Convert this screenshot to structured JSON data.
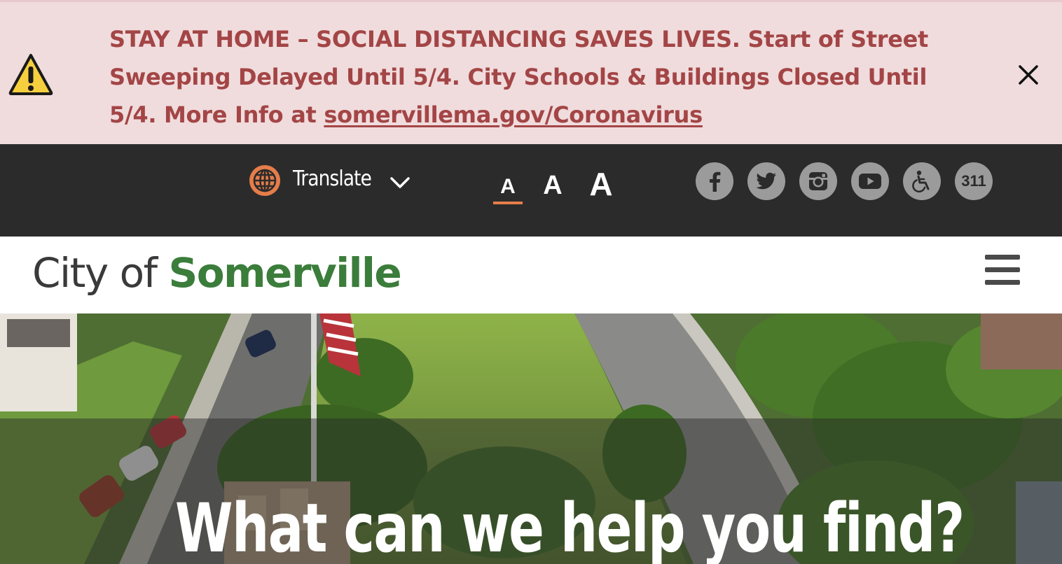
{
  "alert": {
    "text": "STAY AT HOME – SOCIAL DISTANCING SAVES LIVES. Start of Street Sweeping Delayed Until 5/4. City Schools & Buildings Closed Until 5/4. More Info at ",
    "link_text": "somervillema.gov/Coronavirus",
    "icon": "warning-icon",
    "close_icon": "close-icon"
  },
  "utility_bar": {
    "translate_label": "Translate",
    "font_sizes": [
      "A",
      "A",
      "A"
    ],
    "selected_font_size": "small",
    "social": [
      {
        "name": "facebook-icon"
      },
      {
        "name": "twitter-icon"
      },
      {
        "name": "instagram-icon"
      },
      {
        "name": "youtube-icon"
      },
      {
        "name": "accessibility-icon"
      },
      {
        "name": "311-button",
        "label": "311"
      }
    ]
  },
  "header": {
    "logo_prefix": "City of",
    "logo_name": "Somerville",
    "menu_icon": "hamburger-menu-icon"
  },
  "hero": {
    "title": "What can we help you find?"
  },
  "colors": {
    "alert_bg": "#f0dcdd",
    "alert_text": "#a34546",
    "utility_bg": "#2b2b2b",
    "accent": "#e57d4a",
    "brand_green": "#3b7d3b",
    "social_grey": "#9b9b9b"
  }
}
